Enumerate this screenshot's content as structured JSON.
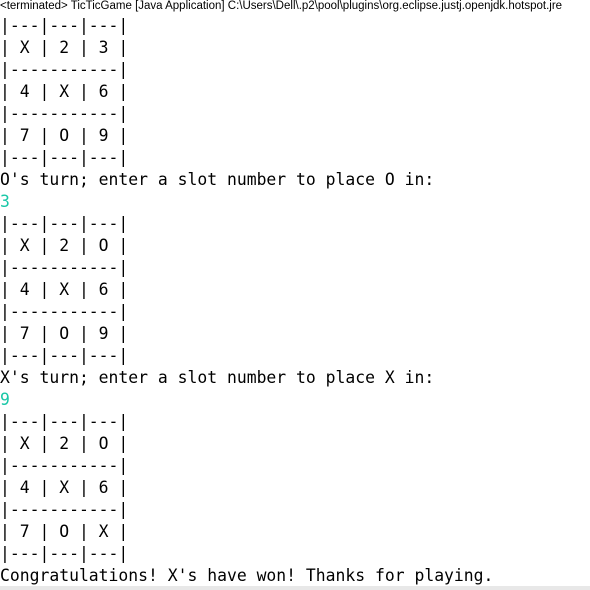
{
  "console": {
    "header": "<terminated> TicTicGame [Java Application] C:\\Users\\Dell\\.p2\\pool\\plugins\\org.eclipse.justj.openjdk.hotspot.jre",
    "input_color": "#19c7a7",
    "lines": [
      {
        "text": "|---|---|---|",
        "kind": "output"
      },
      {
        "text": "| X | 2 | 3 |",
        "kind": "output"
      },
      {
        "text": "|-----------|",
        "kind": "output"
      },
      {
        "text": "| 4 | X | 6 |",
        "kind": "output"
      },
      {
        "text": "|-----------|",
        "kind": "output"
      },
      {
        "text": "| 7 | O | 9 |",
        "kind": "output"
      },
      {
        "text": "|---|---|---|",
        "kind": "output"
      },
      {
        "text": "O's turn; enter a slot number to place O in:",
        "kind": "output"
      },
      {
        "text": "3",
        "kind": "input"
      },
      {
        "text": "|---|---|---|",
        "kind": "output"
      },
      {
        "text": "| X | 2 | O |",
        "kind": "output"
      },
      {
        "text": "|-----------|",
        "kind": "output"
      },
      {
        "text": "| 4 | X | 6 |",
        "kind": "output"
      },
      {
        "text": "|-----------|",
        "kind": "output"
      },
      {
        "text": "| 7 | O | 9 |",
        "kind": "output"
      },
      {
        "text": "|---|---|---|",
        "kind": "output"
      },
      {
        "text": "X's turn; enter a slot number to place X in:",
        "kind": "output"
      },
      {
        "text": "9",
        "kind": "input"
      },
      {
        "text": "|---|---|---|",
        "kind": "output"
      },
      {
        "text": "| X | 2 | O |",
        "kind": "output"
      },
      {
        "text": "|-----------|",
        "kind": "output"
      },
      {
        "text": "| 4 | X | 6 |",
        "kind": "output"
      },
      {
        "text": "|-----------|",
        "kind": "output"
      },
      {
        "text": "| 7 | O | X |",
        "kind": "output"
      },
      {
        "text": "|---|---|---|",
        "kind": "output"
      },
      {
        "text": "Congratulations! X's have won! Thanks for playing.",
        "kind": "output"
      }
    ]
  }
}
